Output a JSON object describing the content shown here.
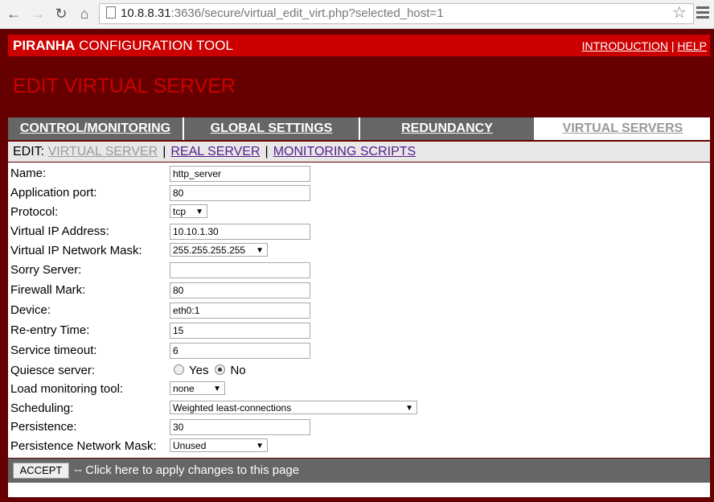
{
  "browser": {
    "url_host": "10.8.8.31",
    "url_path": ":3636/secure/virtual_edit_virt.php?selected_host=1"
  },
  "header": {
    "app_bold": "PIRANHA",
    "app_rest": " CONFIGURATION TOOL",
    "link_intro": "INTRODUCTION",
    "link_sep": " | ",
    "link_help": "HELP"
  },
  "page_title": "EDIT VIRTUAL SERVER",
  "tabs": [
    {
      "label": "CONTROL/MONITORING"
    },
    {
      "label": "GLOBAL SETTINGS"
    },
    {
      "label": "REDUNDANCY"
    },
    {
      "label": "VIRTUAL SERVERS"
    }
  ],
  "subnav": {
    "prefix": "EDIT:",
    "current": "VIRTUAL SERVER",
    "sep": "|",
    "real_server": "REAL SERVER",
    "monitoring_scripts": "MONITORING SCRIPTS"
  },
  "form": {
    "name": {
      "label": "Name:",
      "value": "http_server"
    },
    "app_port": {
      "label": "Application port:",
      "value": "80"
    },
    "protocol": {
      "label": "Protocol:",
      "value": "tcp"
    },
    "vip": {
      "label": "Virtual IP Address:",
      "value": "10.10.1.30"
    },
    "vip_mask": {
      "label": "Virtual IP Network Mask:",
      "value": "255.255.255.255"
    },
    "sorry": {
      "label": "Sorry Server:",
      "value": ""
    },
    "fwmark": {
      "label": "Firewall Mark:",
      "value": "80"
    },
    "device": {
      "label": "Device:",
      "value": "eth0:1"
    },
    "reentry": {
      "label": "Re-entry Time:",
      "value": "15"
    },
    "timeout": {
      "label": "Service timeout:",
      "value": "6"
    },
    "quiesce": {
      "label": "Quiesce server:",
      "yes": "Yes",
      "no": "No"
    },
    "load_tool": {
      "label": "Load monitoring tool:",
      "value": "none"
    },
    "scheduling": {
      "label": "Scheduling:",
      "value": "Weighted least-connections"
    },
    "persistence": {
      "label": "Persistence:",
      "value": "30"
    },
    "persist_mask": {
      "label": "Persistence Network Mask:",
      "value": "Unused"
    }
  },
  "accept": {
    "button": "ACCEPT",
    "text": " -- Click here to apply changes to this page"
  }
}
